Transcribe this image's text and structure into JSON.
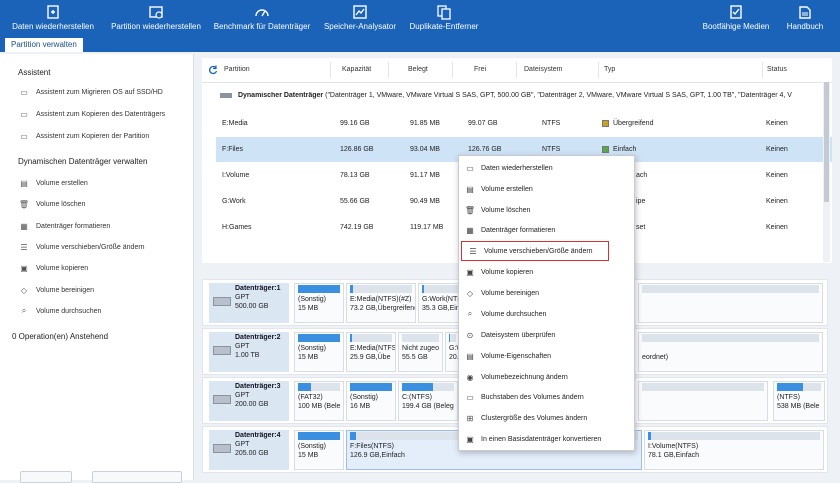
{
  "ribbon": {
    "left_items": [
      {
        "label": "Daten wiederherstellen",
        "icon": "data-recovery-icon"
      },
      {
        "label": "Partition wiederherstellen",
        "icon": "partition-recovery-icon"
      },
      {
        "label": "Benchmark für Datenträger",
        "icon": "benchmark-icon"
      },
      {
        "label": "Speicher-Analysator",
        "icon": "space-analyzer-icon"
      },
      {
        "label": "Duplikate-Entferner",
        "icon": "duplicate-remover-icon"
      }
    ],
    "right_items": [
      {
        "label": "Bootfähige Medien",
        "icon": "bootable-media-icon"
      },
      {
        "label": "Handbuch",
        "icon": "manual-icon"
      }
    ]
  },
  "tab": {
    "label": "Partition verwalten"
  },
  "sidebar": {
    "wizard_title": "Assistent",
    "wizard_items": [
      {
        "label": "Assistent zum Migrieren OS auf SSD/HD",
        "icon": "migrate-os-icon"
      },
      {
        "label": "Assistent zum Kopieren des Datenträgers",
        "icon": "copy-disk-icon"
      },
      {
        "label": "Assistent zum Kopieren der Partition",
        "icon": "copy-partition-icon"
      }
    ],
    "dynamic_title": "Dynamischen Datenträger verwalten",
    "dynamic_items": [
      {
        "label": "Volume erstellen",
        "icon": "create-volume-icon"
      },
      {
        "label": "Volume löschen",
        "icon": "delete-volume-icon"
      },
      {
        "label": "Datenträger formatieren",
        "icon": "format-icon"
      },
      {
        "label": "Volume verschieben/Größe ändern",
        "icon": "move-resize-icon"
      },
      {
        "label": "Volume kopieren",
        "icon": "copy-volume-icon"
      },
      {
        "label": "Volume bereinigen",
        "icon": "wipe-volume-icon"
      },
      {
        "label": "Volume durchsuchen",
        "icon": "explore-volume-icon"
      }
    ],
    "pending": "0 Operation(en) Anstehend"
  },
  "table": {
    "headers": [
      "Partition",
      "Kapazität",
      "Belegt",
      "Frei",
      "Dateisystem",
      "Typ",
      "Status"
    ],
    "disk_title": "Dynamischer Datenträger",
    "disk_desc": "(\"Datenträger 1, VMware, VMware Virtual S SAS, GPT, 500.00 GB\", \"Datenträger 2, VMware, VMware Virtual S SAS, GPT, 1.00 TB\", \"Datenträger 4, V",
    "rows": [
      {
        "partition": "E:Media",
        "capacity": "99.16 GB",
        "used": "91.85 MB",
        "free": "99.07 GB",
        "fs": "NTFS",
        "type": "Übergreifend",
        "status": "Keinen",
        "type_color": "#c8a21f"
      },
      {
        "partition": "F:Files",
        "capacity": "126.86 GB",
        "used": "93.04 MB",
        "free": "126.76 GB",
        "fs": "NTFS",
        "type": "Einfach",
        "status": "Keinen",
        "type_color": "#5aa84a"
      },
      {
        "partition": "I:Volume",
        "capacity": "78.13 GB",
        "used": "91.17 MB",
        "free": "",
        "fs": "",
        "type": "ach",
        "status": "Keinen",
        "type_color": ""
      },
      {
        "partition": "G:Work",
        "capacity": "55.66 GB",
        "used": "90.49 MB",
        "free": "",
        "fs": "",
        "type": "ipe",
        "status": "Keinen",
        "type_color": ""
      },
      {
        "partition": "H:Games",
        "capacity": "742.19 GB",
        "used": "119.17 MB",
        "free": "",
        "fs": "",
        "type": "set",
        "status": "Keinen",
        "type_color": ""
      }
    ]
  },
  "diskmap": [
    {
      "name": "Datenträger:1",
      "style": "GPT",
      "size": "500.00 GB",
      "segments": [
        {
          "l1": "(Sonstig)",
          "l2": "15 MB",
          "fill": 1.0
        },
        {
          "l1": "E:Media(NTFS)(#Z)",
          "l2": "73.2 GB,Übergreifend",
          "fill": 0.05
        },
        {
          "l1": "G:Work(NTFS)",
          "l2": "35.3 GB,Einfa",
          "fill": 0.05
        }
      ]
    },
    {
      "name": "Datenträger:2",
      "style": "GPT",
      "size": "1.00 TB",
      "segments": [
        {
          "l1": "(Sonstig)",
          "l2": "15 MB",
          "fill": 1.0
        },
        {
          "l1": "E:Media(NTFS)",
          "l2": "25.9 GB,Übe",
          "fill": 0.05
        },
        {
          "l1": "Nicht zugeo",
          "l2": "55.5 GB",
          "fill": 0
        },
        {
          "l1": "G:Work(NTF",
          "l2": "20.4 GB,Ein",
          "fill": 0.05
        },
        {
          "l1": "",
          "l2": "",
          "fill": 0
        },
        {
          "l1": "eordnet)",
          "l2": "",
          "fill": 0
        }
      ]
    },
    {
      "name": "Datenträger:3",
      "style": "GPT",
      "size": "200.00 GB",
      "segments": [
        {
          "l1": "(FAT32)",
          "l2": "100 MB (Bele",
          "fill": 0.3
        },
        {
          "l1": "(Sonstig)",
          "l2": "16 MB",
          "fill": 1.0
        },
        {
          "l1": "C:(NTFS)",
          "l2": "199.4 GB (Beleg",
          "fill": 0.6
        },
        {
          "l1": "(NTFS)",
          "l2": "538 MB (Bele",
          "fill": 0.6
        }
      ]
    },
    {
      "name": "Datenträger:4",
      "style": "GPT",
      "size": "205.00 GB",
      "segments": [
        {
          "l1": "(Sonstig)",
          "l2": "15 MB",
          "fill": 1.0
        },
        {
          "l1": "F:Files(NTFS)",
          "l2": "126.9 GB,Einfach",
          "fill": 0.02
        },
        {
          "l1": "I:Volume(NTFS)",
          "l2": "78.1 GB,Einfach",
          "fill": 0.02
        }
      ]
    }
  ],
  "context_menu": [
    {
      "label": "Daten wiederherstellen",
      "icon": "data-recovery-icon"
    },
    {
      "label": "Volume erstellen",
      "icon": "create-volume-icon"
    },
    {
      "label": "Volume löschen",
      "icon": "delete-volume-icon"
    },
    {
      "label": "Datenträger formatieren",
      "icon": "format-icon"
    },
    {
      "label": "Volume verschieben/Größe ändern",
      "icon": "move-resize-icon",
      "highlighted": true
    },
    {
      "label": "Volume kopieren",
      "icon": "copy-volume-icon"
    },
    {
      "label": "Volume bereinigen",
      "icon": "wipe-volume-icon"
    },
    {
      "label": "Volume durchsuchen",
      "icon": "explore-volume-icon"
    },
    {
      "label": "Dateisystem überprüfen",
      "icon": "check-filesystem-icon"
    },
    {
      "label": "Volume-Eigenschaften",
      "icon": "properties-icon"
    },
    {
      "label": "Volumebezeichnung ändern",
      "icon": "change-label-icon"
    },
    {
      "label": "Buchstaben des Volumes ändern",
      "icon": "change-letter-icon"
    },
    {
      "label": "Clustergröße des Volumes ändern",
      "icon": "cluster-size-icon"
    },
    {
      "label": "In einen Basisdatenträger konvertieren",
      "icon": "convert-basic-icon"
    }
  ],
  "colors": {
    "accent": "#1a63b8",
    "selection": "#cfe3f7",
    "highlight_border": "#d63030",
    "usage_bar": "#3b8fe0"
  }
}
